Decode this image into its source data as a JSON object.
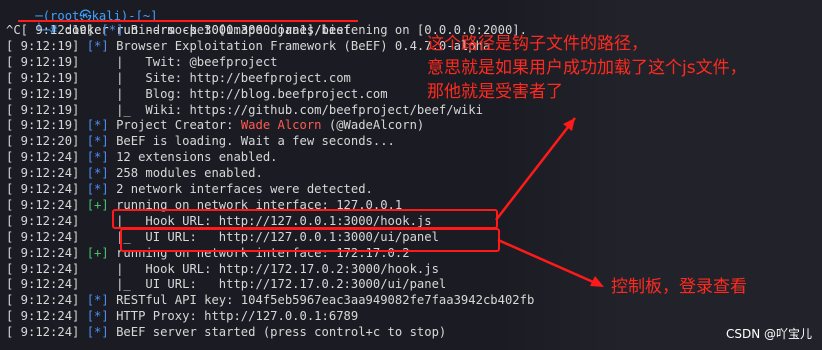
{
  "terminal": {
    "header_fragment": "─(root㉿kali)-[~]",
    "prompt_symbol": "└─#",
    "command": "docker run --rm -p 3000:3000 janes/beef",
    "lines": [
      {
        "ts": "^C[ 9:12:19]",
        "tag": "[*]",
        "text": " Bind socket [imapeudora1] listening on [0.0.0.0:2000]."
      },
      {
        "ts": "[ 9:12:19]",
        "tag": "[*]",
        "text": " Browser Exploitation Framework (BeEF) 0.4.7.0-alpha"
      },
      {
        "ts": "[ 9:12:19]",
        "tag": "",
        "text": "    |   Twit: @beefproject"
      },
      {
        "ts": "[ 9:12:19]",
        "tag": "",
        "text": "    |   Site: http://beefproject.com"
      },
      {
        "ts": "[ 9:12:19]",
        "tag": "",
        "text": "    |   Blog: http://blog.beefproject.com"
      },
      {
        "ts": "[ 9:12:19]",
        "tag": "",
        "text": "    |_  Wiki: https://github.com/beefproject/beef/wiki"
      },
      {
        "ts": "[ 9:12:19]",
        "tag": "[*]",
        "text": " Project Creator: ",
        "red": "Wade Alcorn",
        "after": " (@WadeAlcorn)"
      },
      {
        "ts": "[ 9:12:20]",
        "tag": "[*]",
        "text": " BeEF is loading. Wait a few seconds..."
      },
      {
        "ts": "[ 9:12:24]",
        "tag": "[*]",
        "text": " 12 extensions enabled."
      },
      {
        "ts": "[ 9:12:24]",
        "tag": "[*]",
        "text": " 258 modules enabled."
      },
      {
        "ts": "[ 9:12:24]",
        "tag": "[*]",
        "text": " 2 network interfaces were detected."
      },
      {
        "ts": "[ 9:12:24]",
        "tag": "[+]",
        "text": " running on network interface: 127.0.0.1"
      },
      {
        "ts": "[ 9:12:24]",
        "tag": "",
        "text": "    |   Hook URL: http://127.0.0.1:3000/hook.js"
      },
      {
        "ts": "[ 9:12:24]",
        "tag": "",
        "text": "    |_  UI URL:   http://127.0.0.1:3000/ui/panel"
      },
      {
        "ts": "[ 9:12:24]",
        "tag": "[+]",
        "text": " running on network interface: 172.17.0.2"
      },
      {
        "ts": "[ 9:12:24]",
        "tag": "",
        "text": "    |   Hook URL: http://172.17.0.2:3000/hook.js"
      },
      {
        "ts": "[ 9:12:24]",
        "tag": "",
        "text": "    |_  UI URL:   http://172.17.0.2:3000/ui/panel"
      },
      {
        "ts": "[ 9:12:24]",
        "tag": "[*]",
        "text": " RESTful API key: 104f5eb5967eac3aa949082fe7faa3942cb402fb"
      },
      {
        "ts": "[ 9:12:24]",
        "tag": "[*]",
        "text": " HTTP Proxy: http://127.0.0.1:6789"
      },
      {
        "ts": "[ 9:12:24]",
        "tag": "[*]",
        "text": " BeEF server started (press control+c to stop)"
      }
    ]
  },
  "annotations": {
    "hook_note": "这个路径是钩子文件的路径，\n意思就是如果用户成功加载了这个js文件，\n那他就是受害者了",
    "panel_note": "控制板，登录查看"
  },
  "watermark": "CSDN @吖宝儿",
  "colors": {
    "background": "#1b1c23",
    "annotation_red": "#ff1a1a",
    "tag_blue": "#4f8ff0",
    "tag_green": "#47c26a"
  }
}
